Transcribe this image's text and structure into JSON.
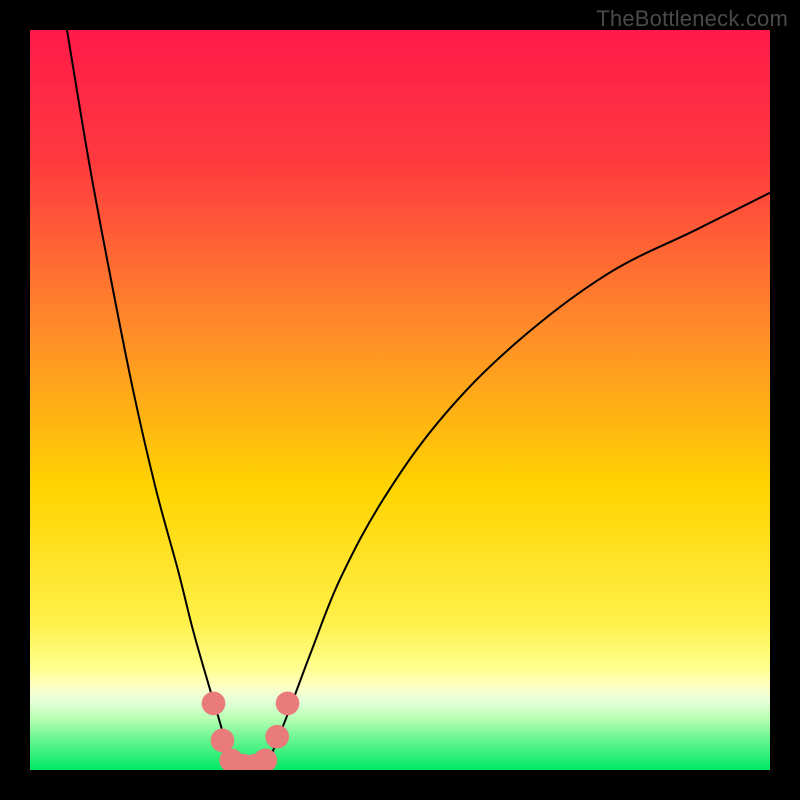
{
  "watermark": "TheBottleneck.com",
  "chart_data": {
    "type": "line",
    "title": "",
    "xlabel": "",
    "ylabel": "",
    "xlim": [
      0,
      100
    ],
    "ylim": [
      0,
      100
    ],
    "grid": false,
    "legend": false,
    "background_gradient": {
      "top_color": "#ff1a49",
      "mid_color": "#ffd400",
      "bottom_band_color": "#ffff8a",
      "base_color": "#00e864"
    },
    "series": [
      {
        "name": "curve-left",
        "x": [
          5,
          8,
          11,
          14,
          17,
          20,
          22,
          24,
          25.5,
          26.5,
          27.5
        ],
        "y": [
          100,
          82,
          66,
          51,
          38,
          27,
          19,
          12,
          7,
          3.5,
          0.5
        ]
      },
      {
        "name": "curve-right",
        "x": [
          32,
          33,
          35,
          38,
          42,
          48,
          56,
          66,
          78,
          90,
          100
        ],
        "y": [
          0.5,
          3,
          8,
          16,
          26,
          37,
          48,
          58,
          67,
          73,
          78
        ]
      }
    ],
    "markers": {
      "name": "accent-dots",
      "color": "#e97b7b",
      "points": [
        {
          "x": 24.8,
          "y": 9.0,
          "r": 1.6
        },
        {
          "x": 26.0,
          "y": 4.0,
          "r": 1.6
        },
        {
          "x": 27.2,
          "y": 1.3,
          "r": 1.6
        },
        {
          "x": 28.8,
          "y": 0.6,
          "r": 1.6
        },
        {
          "x": 30.4,
          "y": 0.6,
          "r": 1.6
        },
        {
          "x": 31.8,
          "y": 1.3,
          "r": 1.6
        },
        {
          "x": 33.4,
          "y": 4.5,
          "r": 1.6
        },
        {
          "x": 34.8,
          "y": 9.0,
          "r": 1.6
        }
      ]
    }
  }
}
